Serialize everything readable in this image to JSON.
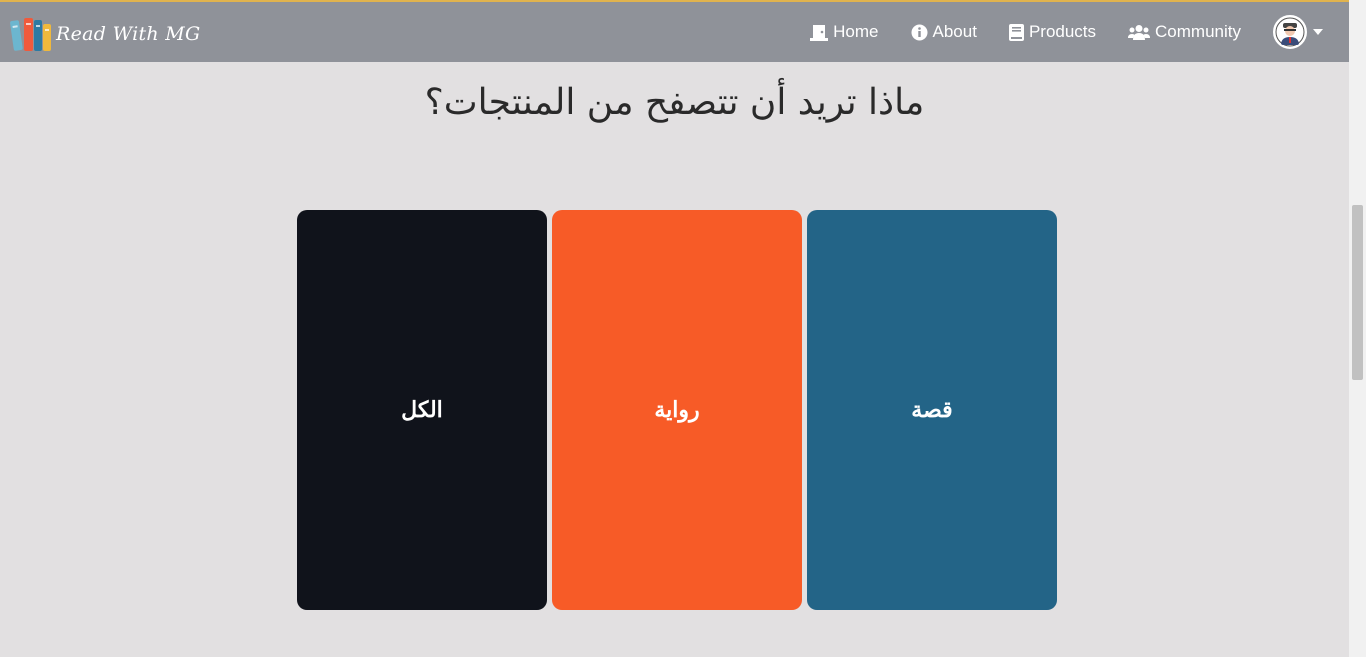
{
  "navbar": {
    "brand": "Read With MG",
    "items": [
      {
        "label": "Home",
        "icon": "door-icon"
      },
      {
        "label": "About",
        "icon": "info-icon"
      },
      {
        "label": "Products",
        "icon": "book-icon"
      },
      {
        "label": "Community",
        "icon": "users-icon"
      }
    ]
  },
  "main": {
    "title": "ماذا تريد أن تتصفح من المنتجات؟",
    "cards": [
      {
        "label": "الكل",
        "color": "#10131b"
      },
      {
        "label": "رواية",
        "color": "#f75b27"
      },
      {
        "label": "قصة",
        "color": "#236487"
      }
    ]
  },
  "colors": {
    "navbar_bg": "#8f9299",
    "page_bg": "#e2e0e1",
    "top_accent": "#e0b34e"
  }
}
